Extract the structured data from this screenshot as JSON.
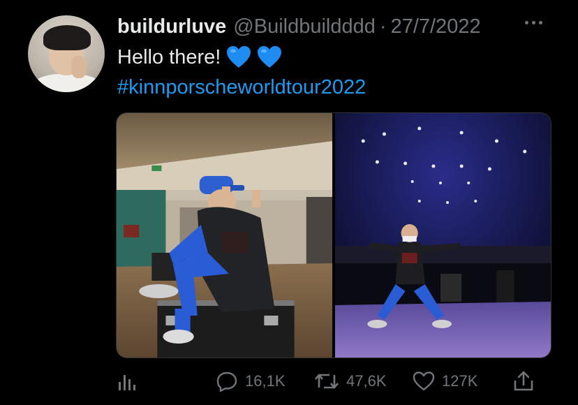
{
  "tweet": {
    "display_name": "buildurluve",
    "handle": "@Buildbuildddd",
    "separator": "·",
    "date": "27/7/2022",
    "text": "Hello there!",
    "emoji": [
      "blue-heart",
      "blue-heart"
    ],
    "hashtag": "#kinnporscheworldtour2022",
    "accent_color": "#1d9bf0",
    "media": [
      {
        "icon": "photo-person-sitting-on-equipment-case"
      },
      {
        "icon": "photo-person-jumping-on-concert-stage"
      }
    ]
  },
  "actions": {
    "analytics_icon": "analytics-icon",
    "reply_count": "16,1K",
    "retweet_count": "47,6K",
    "like_count": "127K",
    "share_icon": "share-icon"
  }
}
